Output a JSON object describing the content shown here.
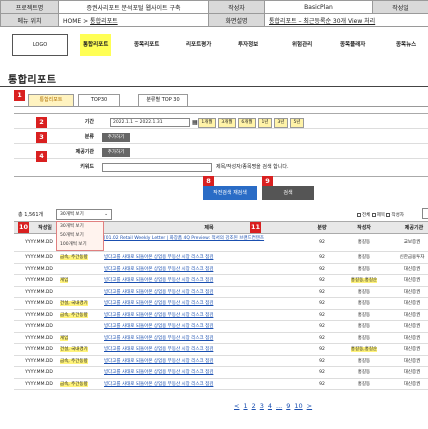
{
  "spec": {
    "project_label": "프로젝트명",
    "project_value": "증권사리포트 분석포털 웹사이트 구축",
    "author_label": "작성자",
    "author_value": "BasicPlan",
    "date_label": "작성일",
    "menu_label": "메뉴 위치",
    "menu_value_prefix": "HOME > ",
    "menu_value_link": "통합리포트",
    "screen_label": "화면설명",
    "screen_value_prefix": "통합리포트 – 최근등록순 30개 View 처리"
  },
  "nav": {
    "logo": "LOGO",
    "items": [
      "통합리포트",
      "종목리포트",
      "리포트평가",
      "투자정보",
      "위험관리",
      "종목플래자",
      "종목뉴스"
    ]
  },
  "page": {
    "title": "통합리포트"
  },
  "badges": [
    "1",
    "2",
    "3",
    "4",
    "8",
    "9",
    "10",
    "11"
  ],
  "tabs": [
    "통합리포트",
    "TOP30",
    "분류별 TOP 30"
  ],
  "search": {
    "period_label": "기간",
    "period_value": "2022.1.1 ~ 2022.1.31",
    "period_buttons": [
      "1개월",
      "3개월",
      "6개월",
      "1년",
      "3년",
      "5년"
    ],
    "category_label": "분류",
    "category_button": "추가하기",
    "provider_label": "제공기관",
    "provider_button": "추가하기",
    "keyword_label": "키워드",
    "keyword_note": "제목/작성자/종목명을 검색 합니다.",
    "reset_button": "작전검색 재검색",
    "search_button": "검색"
  },
  "list": {
    "total": "총 1,561개",
    "page_size": "30개씩 보기",
    "page_size_options": [
      "30개씩 보기",
      "50개씩 보기",
      "100개씩 보기"
    ],
    "filter_all": "전체",
    "filter_title": "제목",
    "filter_author": "작성자",
    "columns": [
      "작성일",
      "제목",
      "분량",
      "작성자",
      "제공기관"
    ]
  },
  "rows": [
    {
      "date": "YYYY.MM.DD",
      "type": "",
      "title": "[01.02 Retail Weekly Letter | 화장품 4Q Preview: 적서의 강조된 브랜드컨텐츠",
      "pages": "92",
      "author": "홍길동",
      "provider": "교보증권",
      "author_hl": false
    },
    {
      "date": "YYYY.MM.DD",
      "type": "금속, 주간동향",
      "title": "빙다고를 사태로 되돌아본 상업용 부동산 시장 리스크 점검",
      "pages": "92",
      "author": "홍길동",
      "provider": "신한금융투자",
      "author_hl": false
    },
    {
      "date": "YYYY.MM.DD",
      "type": "",
      "title": "빙다고를 사태로 되돌아본 상업용 부동산 시장 리스크 점검",
      "pages": "92",
      "author": "홍길동",
      "provider": "대신증권",
      "author_hl": false
    },
    {
      "date": "YYYY.MM.DD",
      "type": "게임",
      "title": "빙다고를 사태로 되돌아본 상업용 부동산 시장 리스크 점검",
      "pages": "92",
      "author": "홍길동,홍길순",
      "provider": "대신증권",
      "author_hl": true
    },
    {
      "date": "YYYY.MM.DD",
      "type": "",
      "title": "빙다고를 사태로 되돌아본 상업용 부동산 시장 리스크 점검",
      "pages": "92",
      "author": "홍길동",
      "provider": "대신증권",
      "author_hl": false
    },
    {
      "date": "YYYY.MM.DD",
      "type": "건설, 국내경기",
      "title": "빙다고를 사태로 되돌아본 상업용 부동산 시장 리스크 점검",
      "pages": "92",
      "author": "홍길동",
      "provider": "대신증권",
      "author_hl": false
    },
    {
      "date": "YYYY.MM.DD",
      "type": "금속, 주간동향",
      "title": "빙다고를 사태로 되돌아본 상업용 부동산 시장 리스크 점검",
      "pages": "92",
      "author": "홍길동",
      "provider": "대신증권",
      "author_hl": false
    },
    {
      "date": "YYYY.MM.DD",
      "type": "",
      "title": "빙다고를 사태로 되돌아본 상업용 부동산 시장 리스크 점검",
      "pages": "92",
      "author": "홍길동",
      "provider": "대신증권",
      "author_hl": false
    },
    {
      "date": "YYYY.MM.DD",
      "type": "게임",
      "title": "빙다고를 사태로 되돌아본 상업용 부동산 시장 리스크 점검",
      "pages": "92",
      "author": "홍길동",
      "provider": "대신증권",
      "author_hl": false
    },
    {
      "date": "YYYY.MM.DD",
      "type": "건설, 국내경기",
      "title": "빙다고를 사태로 되돌아본 상업용 부동산 시장 리스크 점검",
      "pages": "92",
      "author": "홍길동,홍길순",
      "provider": "대신증권",
      "author_hl": true
    },
    {
      "date": "YYYY.MM.DD",
      "type": "금속, 주간동향",
      "title": "빙다고를 사태로 되돌아본 상업용 부동산 시장 리스크 점검",
      "pages": "92",
      "author": "홍길동",
      "provider": "대신증권",
      "author_hl": false
    },
    {
      "date": "YYYY.MM.DD",
      "type": "",
      "title": "빙다고를 사태로 되돌아본 상업용 부동산 시장 리스크 점검",
      "pages": "92",
      "author": "홍길동",
      "provider": "대신증권",
      "author_hl": false
    },
    {
      "date": "YYYY.MM.DD",
      "type": "금속, 주간동향",
      "title": "빙다고를 사태로 되돌아본 상업용 부동산 시장 리스크 점검",
      "pages": "92",
      "author": "홍길동",
      "provider": "대신증권",
      "author_hl": false
    }
  ],
  "pager": [
    "<",
    "1",
    "2",
    "3",
    "4",
    "...",
    "9",
    "10",
    ">"
  ],
  "colors": {
    "accent": "#ffff55",
    "badge": "#d92020",
    "reset_button": "#2a6cc6",
    "search_button": "#555555",
    "link": "#1a4fb0"
  }
}
